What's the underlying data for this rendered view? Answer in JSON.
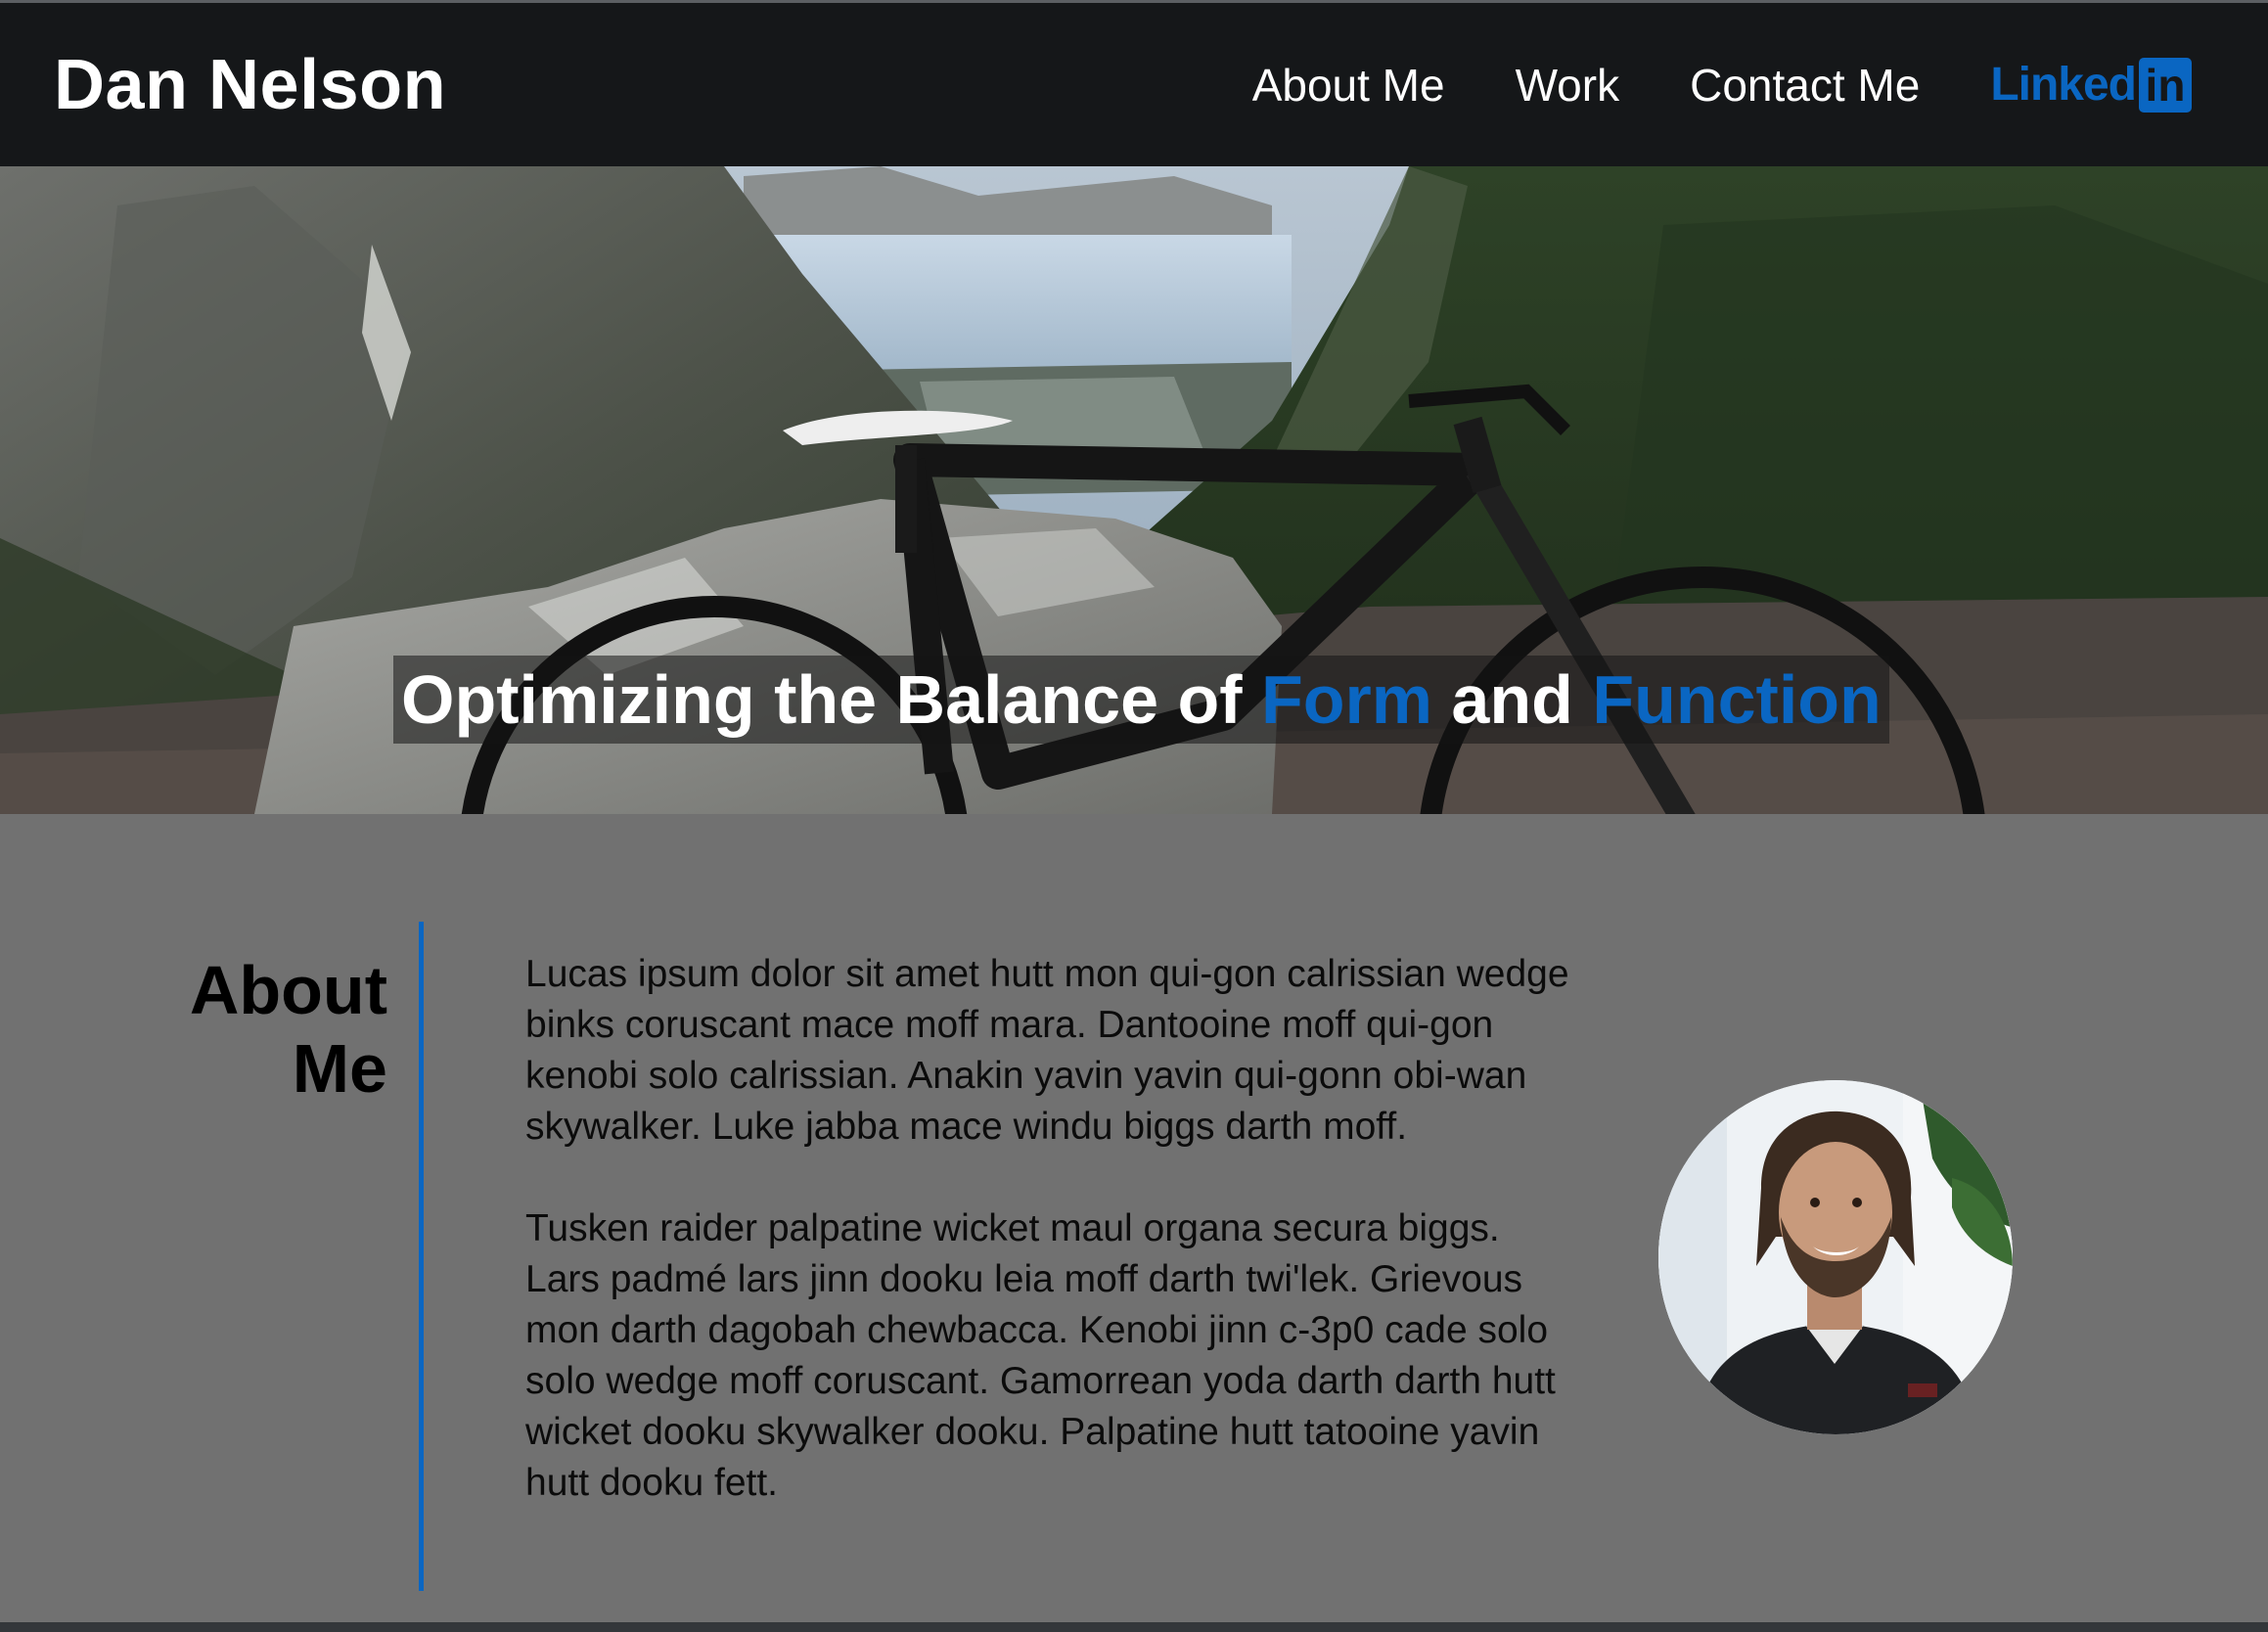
{
  "header": {
    "site_title": "Dan Nelson",
    "nav": {
      "about": "About Me",
      "work": "Work",
      "contact": "Contact Me"
    },
    "linkedin": {
      "text": "Linked",
      "box": "in",
      "icon": "linkedin-logo",
      "color": "#0a66c2"
    }
  },
  "hero": {
    "tagline": {
      "part1": "Optimizing the Balance of ",
      "accent1": "Form",
      "part2": " and ",
      "accent2": "Function"
    },
    "image": "mountain-bike-overlook-photo"
  },
  "about": {
    "heading": "About Me",
    "paragraphs": [
      "Lucas ipsum dolor sit amet hutt mon qui-gon calrissian wedge binks coruscant mace moff mara. Dantooine moff qui-gon kenobi solo calrissian. Anakin yavin yavin qui-gonn obi-wan skywalker. Luke jabba mace windu biggs darth moff.",
      "Tusken raider palpatine wicket maul organa secura biggs. Lars padmé lars jinn dooku leia moff darth twi'lek. Grievous mon darth dagobah chewbacca. Kenobi jinn c-3p0 cade solo solo wedge moff coruscant. Gamorrean yoda darth darth hutt wicket dooku skywalker dooku. Palpatine hutt tatooine yavin hutt dooku fett."
    ],
    "portrait": "profile-photo"
  },
  "colors": {
    "header_bg": "#151719",
    "accent": "#0a66c2",
    "about_bg": "#717171"
  }
}
